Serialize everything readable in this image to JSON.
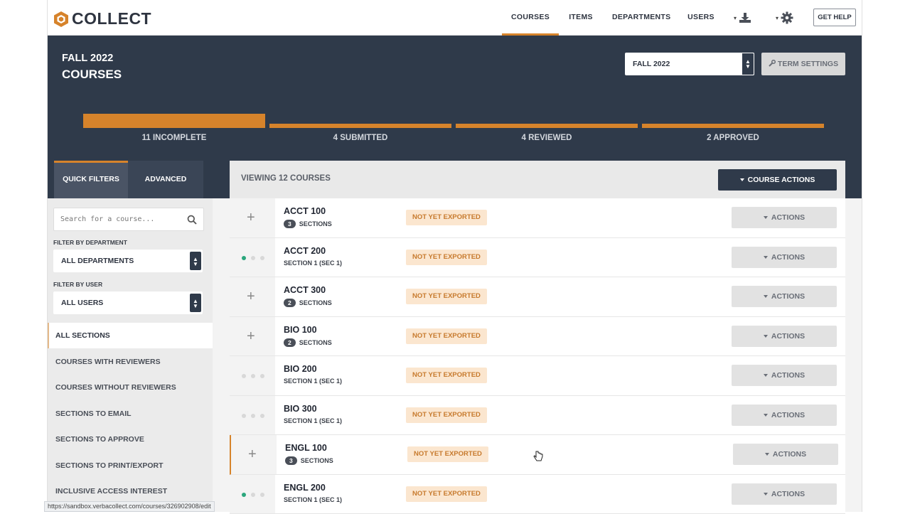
{
  "brand": {
    "name": "COLLECT",
    "accent": "#d6832b",
    "dark": "#2f3a4a"
  },
  "nav": {
    "items": [
      {
        "label": "COURSES",
        "active": true
      },
      {
        "label": "ITEMS",
        "active": false
      },
      {
        "label": "DEPARTMENTS",
        "active": false
      },
      {
        "label": "USERS",
        "active": false
      }
    ],
    "download_icon": "download-icon",
    "settings_icon": "gear-icon",
    "help_label": "GET HELP"
  },
  "hero": {
    "term": "FALL 2022",
    "title": "COURSES",
    "term_select": "FALL 2022",
    "term_settings": "TERM SETTINGS",
    "stages": [
      {
        "label": "11 INCOMPLETE",
        "current": true
      },
      {
        "label": "4 SUBMITTED",
        "current": false
      },
      {
        "label": "4 REVIEWED",
        "current": false
      },
      {
        "label": "2 APPROVED",
        "current": false
      }
    ]
  },
  "filters": {
    "tabs": [
      {
        "label": "QUICK FILTERS",
        "active": true
      },
      {
        "label": "ADVANCED",
        "active": false
      }
    ],
    "search_placeholder": "Search for a course...",
    "department_label": "FILTER BY DEPARTMENT",
    "department_value": "ALL DEPARTMENTS",
    "user_label": "FILTER BY USER",
    "user_value": "ALL USERS",
    "items": [
      {
        "label": "ALL SECTIONS",
        "active": true
      },
      {
        "label": "COURSES WITH REVIEWERS",
        "active": false
      },
      {
        "label": "COURSES WITHOUT REVIEWERS",
        "active": false
      },
      {
        "label": "SECTIONS TO EMAIL",
        "active": false
      },
      {
        "label": "SECTIONS TO APPROVE",
        "active": false
      },
      {
        "label": "SECTIONS TO PRINT/EXPORT",
        "active": false
      },
      {
        "label": "INCLUSIVE ACCESS INTEREST",
        "active": false
      }
    ]
  },
  "courses": {
    "viewing": "VIEWING 12 COURSES",
    "course_actions": "COURSE ACTIONS",
    "rows": [
      {
        "name": "ACCT 100",
        "kind": "expand",
        "count": "3",
        "sub": "SECTIONS",
        "status": "NOT YET EXPORTED",
        "action": "ACTIONS",
        "dots": []
      },
      {
        "name": "ACCT 200",
        "kind": "dots",
        "count": "",
        "sub": "SECTION 1 (SEC 1)",
        "status": "NOT YET EXPORTED",
        "action": "ACTIONS",
        "dots": [
          1,
          0,
          0
        ]
      },
      {
        "name": "ACCT 300",
        "kind": "expand",
        "count": "2",
        "sub": "SECTIONS",
        "status": "NOT YET EXPORTED",
        "action": "ACTIONS",
        "dots": []
      },
      {
        "name": "BIO 100",
        "kind": "expand",
        "count": "2",
        "sub": "SECTIONS",
        "status": "NOT YET EXPORTED",
        "action": "ACTIONS",
        "dots": []
      },
      {
        "name": "BIO 200",
        "kind": "dots",
        "count": "",
        "sub": "SECTION 1 (SEC 1)",
        "status": "NOT YET EXPORTED",
        "action": "ACTIONS",
        "dots": [
          0,
          0,
          0
        ]
      },
      {
        "name": "BIO 300",
        "kind": "dots",
        "count": "",
        "sub": "SECTION 1 (SEC 1)",
        "status": "NOT YET EXPORTED",
        "action": "ACTIONS",
        "dots": [
          0,
          0,
          0
        ]
      },
      {
        "name": "ENGL 100",
        "kind": "expand",
        "count": "3",
        "sub": "SECTIONS",
        "status": "NOT YET EXPORTED",
        "action": "ACTIONS",
        "dots": [],
        "highlight": true
      },
      {
        "name": "ENGL 200",
        "kind": "dots",
        "count": "",
        "sub": "SECTION 1 (SEC 1)",
        "status": "NOT YET EXPORTED",
        "action": "ACTIONS",
        "dots": [
          1,
          0,
          0
        ]
      }
    ]
  },
  "statusbar": {
    "url": "https://sandbox.verbacollect.com/courses/326902908/edit"
  }
}
